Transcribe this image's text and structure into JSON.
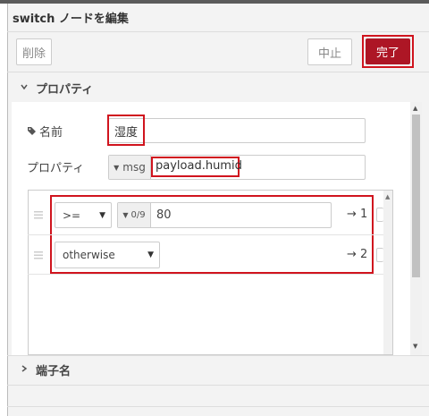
{
  "dialog": {
    "title": "switch ノードを編集",
    "buttons": {
      "delete": "削除",
      "cancel": "中止",
      "done": "完了"
    }
  },
  "properties_section": {
    "header": "プロパティ",
    "name_label": "名前",
    "name_value": "湿度",
    "property_label": "プロパティ",
    "property_type": "msg",
    "property_value": "payload.humid"
  },
  "rules": [
    {
      "operator": ">=",
      "value_type_icon": "0/9",
      "value": "80",
      "output": "→ 1"
    },
    {
      "operator": "otherwise",
      "output": "→ 2"
    }
  ],
  "ports_section": {
    "header": "端子名"
  },
  "icons": {
    "tag": "tag-icon",
    "expand": "chevron-down-icon",
    "collapse": "chevron-right-icon",
    "drag": "drag-handle-icon"
  },
  "colors": {
    "primary": "#ad1625",
    "highlight": "#d0141e"
  }
}
